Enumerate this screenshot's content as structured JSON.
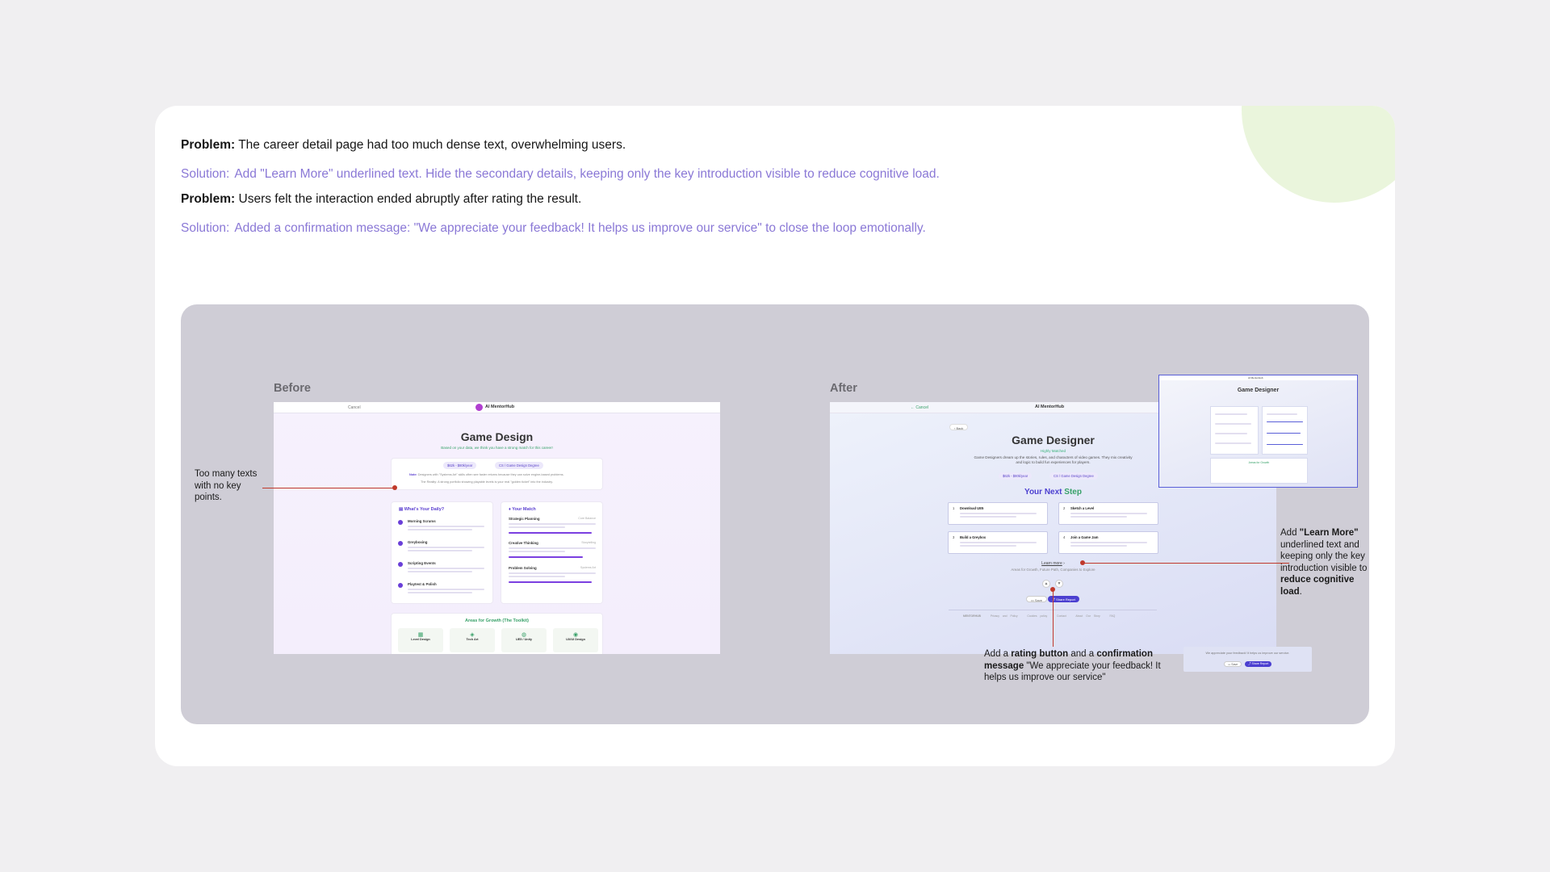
{
  "problems": [
    {
      "label": "Problem:",
      "text": "The career detail page had too much dense text, overwhelming users."
    },
    {
      "label": "Solution:",
      "text": "Add \"Learn More\" underlined text. Hide the secondary details, keeping only the key introduction visible to reduce cognitive load."
    },
    {
      "label": "Problem:",
      "text": "Users felt the interaction ended abruptly after rating the result."
    },
    {
      "label": "Solution:",
      "text": "Added a confirmation message: \"We appreciate your feedback! It helps us improve our service\" to close the loop emotionally."
    }
  ],
  "before": {
    "label": "Before",
    "topbar": {
      "cancel": "Cancel",
      "brand": "AI MentorHub"
    },
    "title": "Game Design",
    "subtitle": "Based on your data, we think you have a strong match for this career!",
    "chips": [
      "$62k - $80k/year",
      "CS / Game Design Degree"
    ],
    "intro_lead": "Note:",
    "intro": "Designers with \"Systems Art\" skills often see faster returns because they can solve engine-based problems.",
    "intro2": "The Reality: A strong portfolio showing playable levels is your real \"golden ticket\" into the industry.",
    "daily": {
      "title": "What's Your Daily?",
      "items": [
        {
          "title": "Morning Scrums",
          "text": "Aligning with art and code teams to ensure the design fits technical constraints."
        },
        {
          "title": "Greyboxing",
          "text": "Building mini-prototypes with simple 3D shapes to feel-player flow and pacing."
        },
        {
          "title": "Scripting Events",
          "text": "Writing simple logic, such as door puzzles to mechanical triggers."
        },
        {
          "title": "Playtest & Polish",
          "text": "Watching others play your level and fixing points of player frustration."
        }
      ]
    },
    "match": {
      "title": "Your Match",
      "items": [
        {
          "title": "Strategic Planning",
          "tag": "Core Balance",
          "text": "Seeing how game systems or recipes interact to balance the ad-hoc challenge.",
          "level": 0.95
        },
        {
          "title": "Creative Thinking",
          "tag": "Storytelling",
          "text": "Using drawing and fantasy backgrounds to think up new world concepts.",
          "level": 0.85
        },
        {
          "title": "Problem Solving",
          "tag": "Systems Art",
          "text": "Helps you streamline \"fun\" ideas into working pieces of implementation.",
          "level": 0.95
        }
      ]
    },
    "growth": {
      "title": "Areas for Growth (The Toolkit)",
      "items": [
        "Level Design",
        "Tech Art",
        "UE5 / Unity",
        "UX/UI Design"
      ]
    }
  },
  "after": {
    "label": "After",
    "topbar": {
      "cancel": "Cancel",
      "brand": "AI MentorHub"
    },
    "back": "Back",
    "title": "Game Designer",
    "match_tag": "Highly Matched",
    "intro": "Game Designers dream up the stories, rules, and characters of video games. They mix creativity and logic to build fun experiences for players.",
    "chips": [
      "$62k - $80k/year",
      "CS / Game Design Degree"
    ],
    "next_step_title_1": "Your Next",
    "next_step_title_2": "Step",
    "steps": [
      {
        "n": "1",
        "title": "Download UE5",
        "text": "It's free and a great start for building a fantasy world."
      },
      {
        "n": "2",
        "title": "Sketch a Level",
        "text": "Draw a top-down view of a quest from your favorite fantasy book or movie."
      },
      {
        "n": "3",
        "title": "Build a Greybox",
        "text": "Recreate your sketch in the engine using cubes."
      },
      {
        "n": "4",
        "title": "Join a Game Jam",
        "text": "Enter weekend challenges on itch.io to build your portfolio."
      }
    ],
    "learn_more": "Learn more",
    "learn_more_sub": "Areas for Growth, Future Path, Companies to Explore",
    "save": "Save",
    "share": "Share Report",
    "footer": [
      "MENTORHUB",
      "Privacy and Policy",
      "Cookies policy",
      "Contact",
      "About Our Story",
      "FAQ"
    ],
    "inset": {
      "brand": "AI MentorHub",
      "title": "Game Designer",
      "growth": "Areas for Growth"
    },
    "confirmation": "We appreciate your feedback! It helps us improve our service.",
    "conf_save": "Save",
    "conf_share": "Share Report"
  },
  "annotations": {
    "before_note": "Too many texts with no key points.",
    "learn_more_note": {
      "p1": "Add ",
      "b1": "\"Learn More\"",
      "p2": " underlined text and keeping only the key introduction visible to ",
      "b2": "reduce cognitive load",
      "p3": "."
    },
    "rating_note": {
      "p1": "Add a ",
      "b1": "rating button",
      "p2": " and a ",
      "b2": "confirmation message",
      "p3": " \"We appreciate your feedback! It helps us improve our service\""
    }
  },
  "colors": {
    "accent": "#8a78d6",
    "annotation_line": "#c0392b",
    "panel": "#cfcdd6",
    "brand_purple": "#6a3fd8",
    "match_green": "#38a169"
  }
}
